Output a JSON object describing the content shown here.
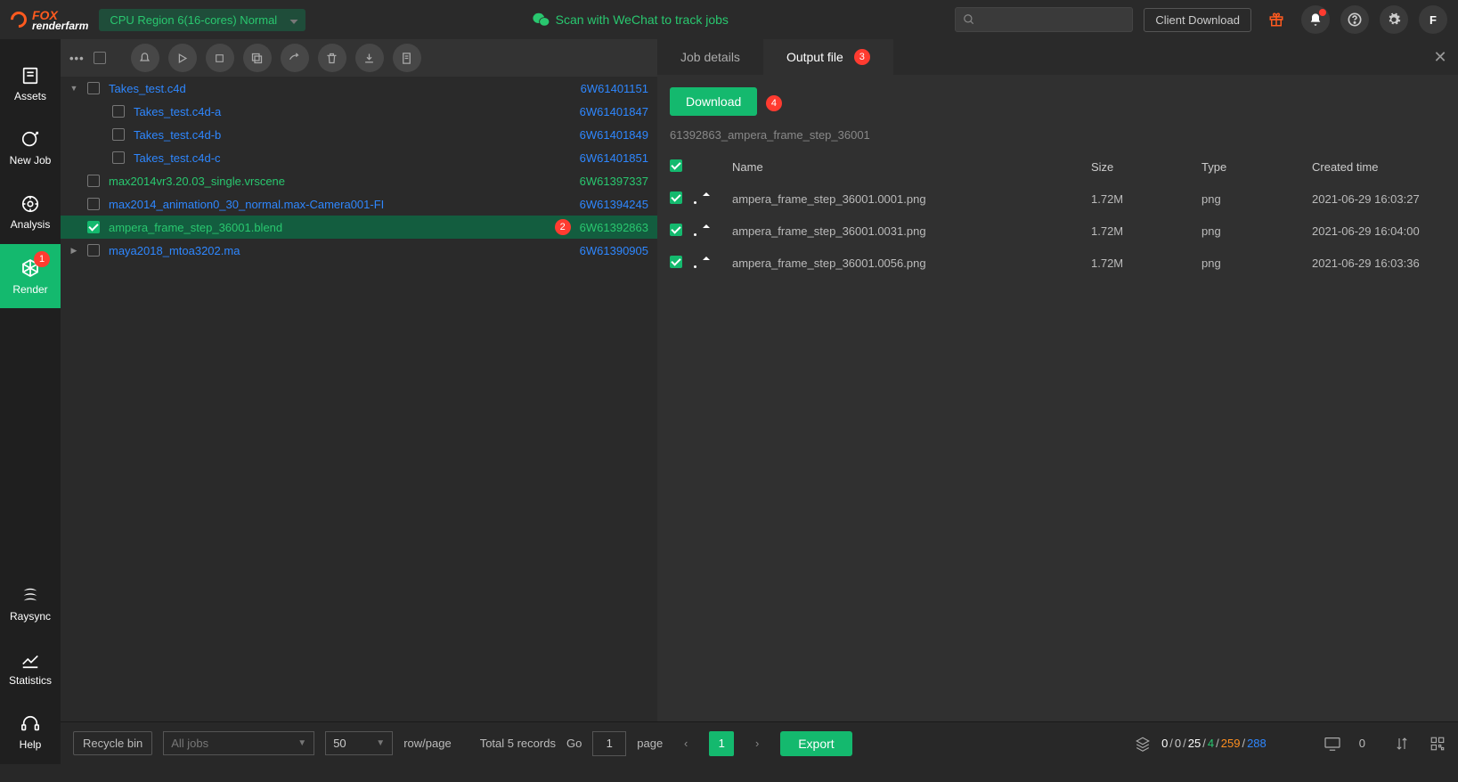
{
  "brand": {
    "line1": "FOX",
    "line2": "renderfarm"
  },
  "region": "CPU Region 6(16-cores)  Normal",
  "wechat": "Scan with WeChat to track jobs",
  "search_placeholder": "",
  "client_download": "Client Download",
  "avatar_letter": "F",
  "sidebar": {
    "assets": "Assets",
    "newjob": "New Job",
    "analysis": "Analysis",
    "render": "Render",
    "render_badge": "1",
    "raysync": "Raysync",
    "statistics": "Statistics",
    "help": "Help"
  },
  "jobs": [
    {
      "indent": 0,
      "caret": "▼",
      "checked": false,
      "name": "Takes_test.c4d",
      "id": "6W61401151",
      "sel": false,
      "green": false
    },
    {
      "indent": 1,
      "caret": "",
      "checked": false,
      "name": "Takes_test.c4d-a",
      "id": "6W61401847",
      "sel": false,
      "green": false
    },
    {
      "indent": 1,
      "caret": "",
      "checked": false,
      "name": "Takes_test.c4d-b",
      "id": "6W61401849",
      "sel": false,
      "green": false
    },
    {
      "indent": 1,
      "caret": "",
      "checked": false,
      "name": "Takes_test.c4d-c",
      "id": "6W61401851",
      "sel": false,
      "green": false
    },
    {
      "indent": 0,
      "caret": "",
      "checked": false,
      "name": "max2014vr3.20.03_single.vrscene",
      "id": "6W61397337",
      "sel": false,
      "green": true
    },
    {
      "indent": 0,
      "caret": "",
      "checked": false,
      "name": "max2014_animation0_30_normal.max-Camera001-FI",
      "id": "6W61394245",
      "sel": false,
      "green": false
    },
    {
      "indent": 0,
      "caret": "",
      "checked": true,
      "name": "ampera_frame_step_36001.blend",
      "id": "6W61392863",
      "sel": true,
      "green": true,
      "badge": "2"
    },
    {
      "indent": 0,
      "caret": "▶",
      "checked": false,
      "name": "maya2018_mtoa3202.ma",
      "id": "6W61390905",
      "sel": false,
      "green": false
    }
  ],
  "tabs": {
    "job_details": "Job details",
    "output_file": "Output file",
    "output_badge": "3"
  },
  "download_label": "Download",
  "download_badge": "4",
  "filepath": "61392863_ampera_frame_step_36001",
  "file_headers": {
    "name": "Name",
    "size": "Size",
    "type": "Type",
    "created": "Created time"
  },
  "files": [
    {
      "name": "ampera_frame_step_36001.0001.png",
      "size": "1.72M",
      "type": "png",
      "created": "2021-06-29 16:03:27"
    },
    {
      "name": "ampera_frame_step_36001.0031.png",
      "size": "1.72M",
      "type": "png",
      "created": "2021-06-29 16:04:00"
    },
    {
      "name": "ampera_frame_step_36001.0056.png",
      "size": "1.72M",
      "type": "png",
      "created": "2021-06-29 16:03:36"
    }
  ],
  "footer": {
    "recycle": "Recycle bin",
    "alljobs": "All jobs",
    "rows_num": "50",
    "rows_label": "row/page",
    "total": "Total 5 records",
    "go": "Go",
    "page_input": "1",
    "page_label": "page",
    "current_page": "1",
    "export": "Export",
    "stats": {
      "a": "0",
      "b": "0",
      "c": "25",
      "d": "4",
      "e": "259",
      "f": "288"
    },
    "monitor": "0"
  }
}
